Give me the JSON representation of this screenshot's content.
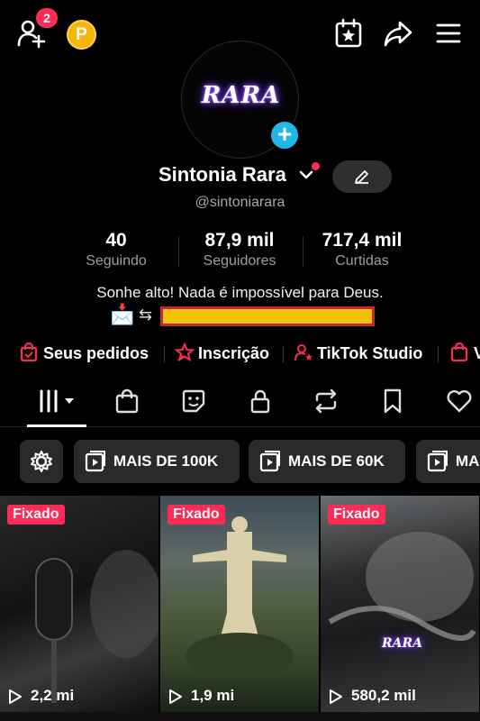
{
  "header": {
    "friend_requests_badge": "2",
    "coin_letter": "P"
  },
  "profile": {
    "avatar_text": "RARA",
    "name": "Sintonia Rara",
    "handle": "@sintoniarara",
    "bio": "Sonhe alto! Nada é impossível para Deus.",
    "link_arrows": "⇆"
  },
  "stats": [
    {
      "value": "40",
      "label": "Seguindo"
    },
    {
      "value": "87,9 mil",
      "label": "Seguidores"
    },
    {
      "value": "717,4 mil",
      "label": "Curtidas"
    }
  ],
  "shortcuts": [
    {
      "label": "Seus pedidos",
      "icon": "shopping-bag-icon"
    },
    {
      "label": "Inscrição",
      "icon": "subscription-star-icon"
    },
    {
      "label": "TikTok Studio",
      "icon": "studio-person-icon"
    },
    {
      "label": "V",
      "icon": "shopping-bag-icon"
    }
  ],
  "tabs": [
    "videos-grid",
    "shop",
    "sticker",
    "private",
    "reposts",
    "favorites",
    "liked"
  ],
  "filters": [
    {
      "label": "",
      "icon": "gear-icon"
    },
    {
      "label": "MAIS DE 100K",
      "icon": "video-icon"
    },
    {
      "label": "MAIS DE 60K",
      "icon": "video-icon"
    },
    {
      "label": "MA",
      "icon": "video-icon"
    }
  ],
  "videos": [
    {
      "pinned": "Fixado",
      "views": "2,2 mi"
    },
    {
      "pinned": "Fixado",
      "views": "1,9 mi"
    },
    {
      "pinned": "Fixado",
      "views": "580,2 mil",
      "overlay_text": "RARA"
    }
  ],
  "colors": {
    "accent": "#fe2c55",
    "background": "#000000",
    "chip_bg": "#2a2a2a",
    "avatar_add": "#20b8e8"
  }
}
